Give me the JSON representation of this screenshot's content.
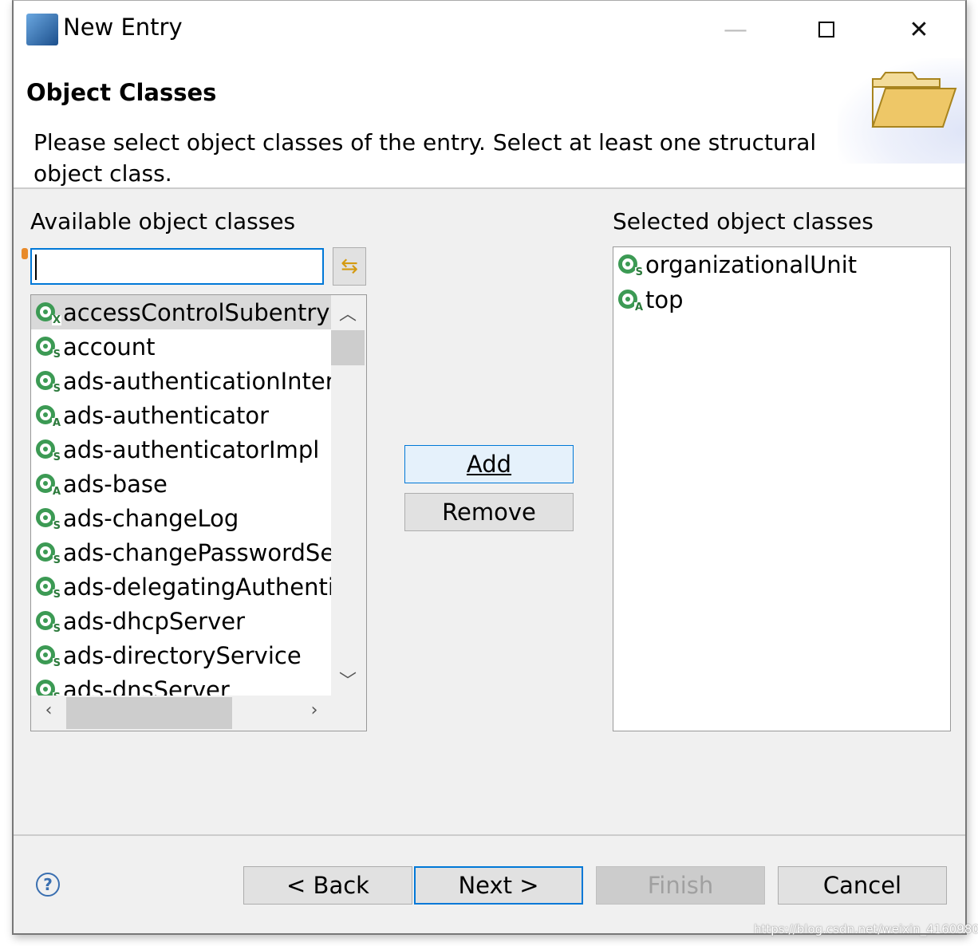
{
  "window": {
    "title": "New Entry",
    "minimize_icon": "minimize-icon",
    "maximize_icon": "maximize-icon",
    "close_icon": "close-icon"
  },
  "header": {
    "title": "Object Classes",
    "description": "Please select object classes of the entry. Select at least one structural object class."
  },
  "available": {
    "label": "Available object classes",
    "filter_value": "",
    "items": [
      {
        "name": "accessControlSubentry",
        "kind": "X",
        "selected": true
      },
      {
        "name": "account",
        "kind": "S"
      },
      {
        "name": "ads-authenticationInter",
        "kind": "S"
      },
      {
        "name": "ads-authenticator",
        "kind": "A"
      },
      {
        "name": "ads-authenticatorImpl",
        "kind": "S"
      },
      {
        "name": "ads-base",
        "kind": "A"
      },
      {
        "name": "ads-changeLog",
        "kind": "S"
      },
      {
        "name": "ads-changePasswordSe",
        "kind": "S"
      },
      {
        "name": "ads-delegatingAuthenti",
        "kind": "S"
      },
      {
        "name": "ads-dhcpServer",
        "kind": "S"
      },
      {
        "name": "ads-directoryService",
        "kind": "S"
      },
      {
        "name": "ads-dnsServer",
        "kind": "S"
      }
    ]
  },
  "selected": {
    "label": "Selected object classes",
    "items": [
      {
        "name": "organizationalUnit",
        "kind": "S"
      },
      {
        "name": "top",
        "kind": "A"
      }
    ]
  },
  "buttons": {
    "add": "Add",
    "remove": "Remove",
    "back": "< Back",
    "next": "Next >",
    "finish": "Finish",
    "cancel": "Cancel"
  },
  "colors": {
    "accent": "#0078d7",
    "objectclass_icon": "#3c9a54"
  },
  "watermark": "https://blog.csdn.net/weixin_41609807"
}
